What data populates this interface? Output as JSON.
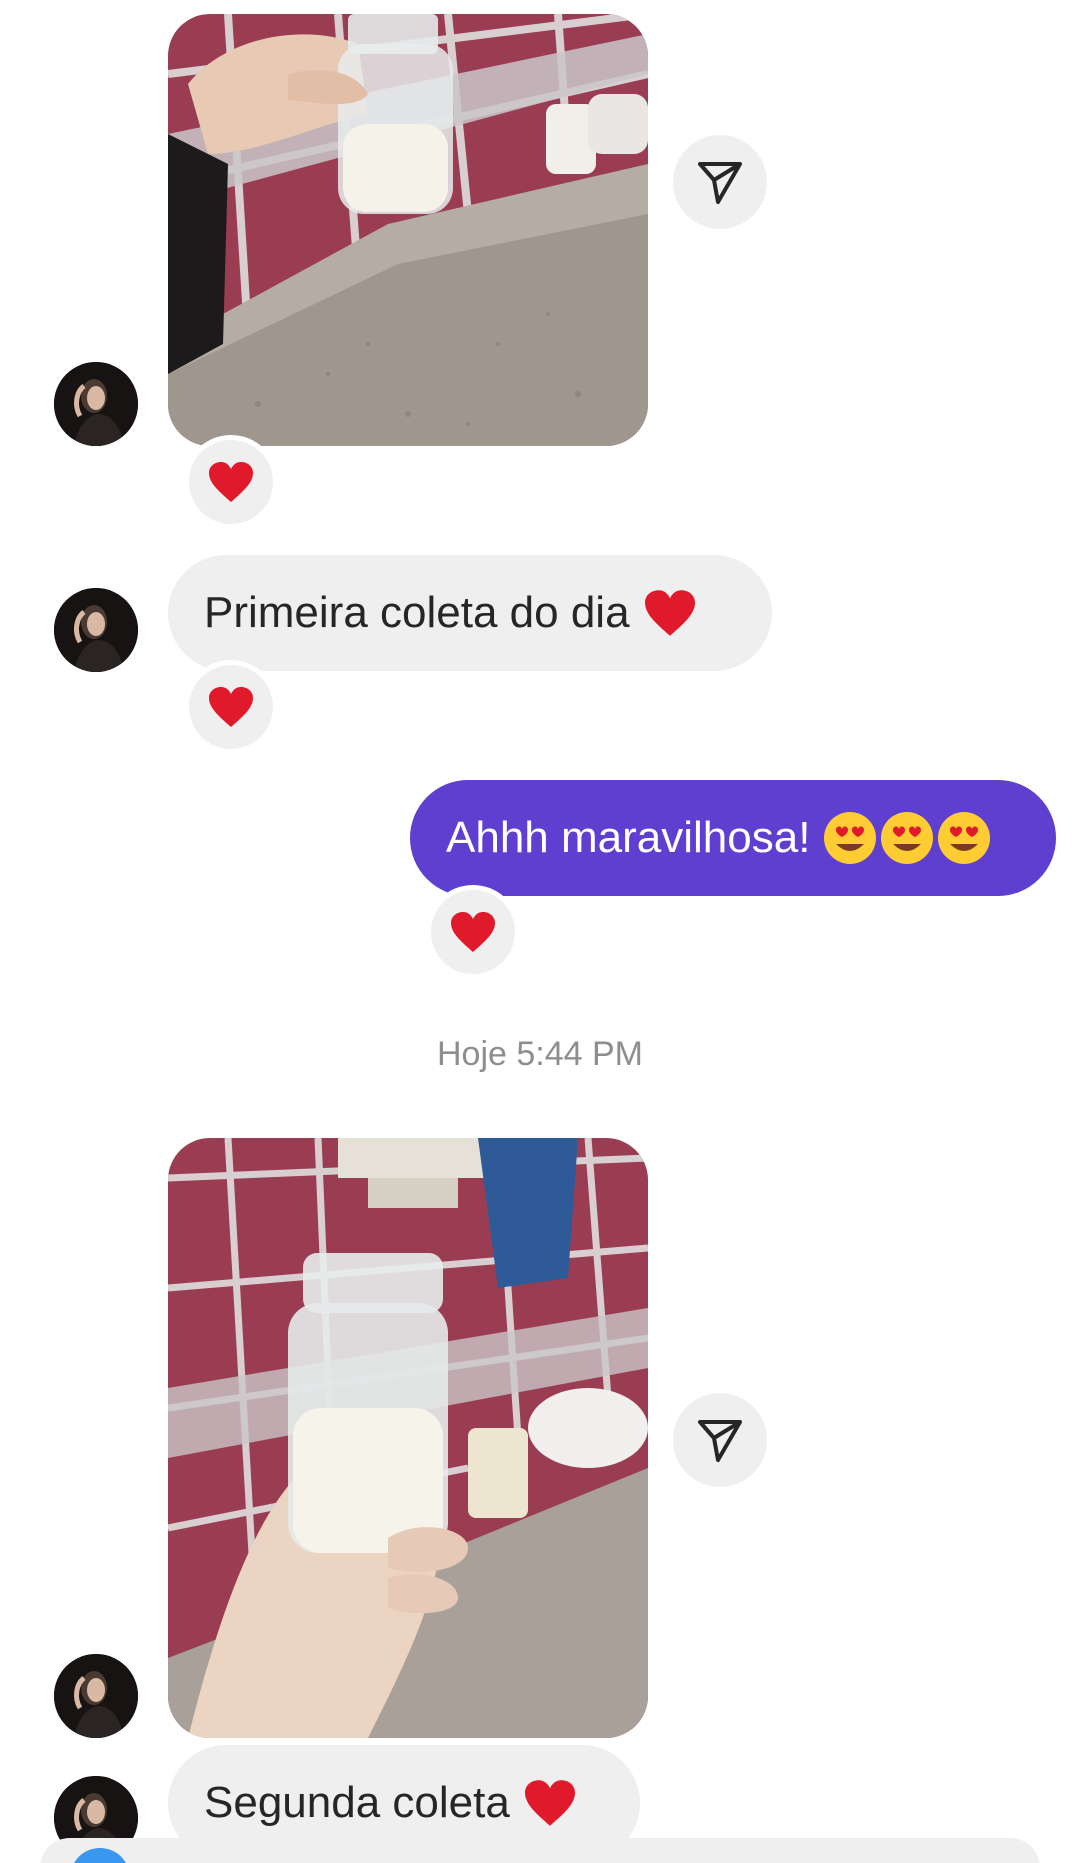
{
  "thread": {
    "timestamp": "Hoje 5:44 PM",
    "messages": [
      {
        "type": "photo",
        "sender": "them",
        "description_icon": "milk-bottle-photo",
        "reaction": "❤️"
      },
      {
        "type": "text",
        "sender": "them",
        "text": "Primeira coleta do dia",
        "emoji": "❤️",
        "reaction": "❤️"
      },
      {
        "type": "text",
        "sender": "me",
        "text": "Ahhh maravilhosa!",
        "emoji": "😍😍😍",
        "reaction": "❤️"
      },
      {
        "type": "photo",
        "sender": "them",
        "description_icon": "milk-bottle-photo"
      },
      {
        "type": "text",
        "sender": "them",
        "text": "Segunda coleta",
        "emoji": "❤️"
      }
    ]
  },
  "colors": {
    "outgoing_bubble": "#5e3fd0",
    "incoming_bubble": "#efefef",
    "timestamp_text": "#8e8e8e",
    "reaction_heart": "#e0192b"
  }
}
